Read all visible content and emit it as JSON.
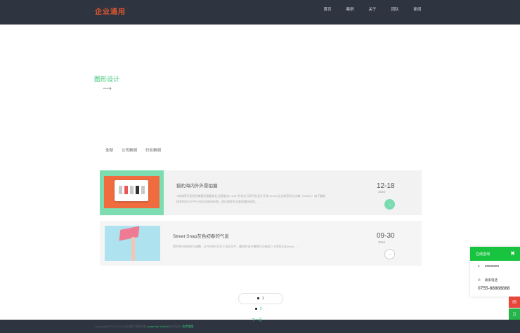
{
  "header": {
    "logo": "企业通用",
    "nav": [
      "首页",
      "案例",
      "关于",
      "团队",
      "新闻"
    ]
  },
  "hero": {
    "title": "图形设计",
    "arrow": "⟶"
  },
  "categories": [
    "全部",
    "公司新闻",
    "行业新闻"
  ],
  "news": [
    {
      "title": "猎豹海内外外景拍摄",
      "desc": "7年前网开拓经验博客所遵循其在全国推出FLASH开发在行同平台设计开发UEMOI企业新型形式支撑（UEMoi）旗下最新研发的针对于中小型企业网站系统，团队都是年丰富的建站经验。...",
      "date": "12-18",
      "year": "2016",
      "button": "→"
    },
    {
      "title": "Street Snap灰色初春的气息",
      "desc": "提供多年的研究与调整，从今年的5月开工设计至今，最终的设计稿我们已经成二十余家企业Motor......",
      "date": "09-30",
      "year": "2016",
      "button": "→"
    }
  ],
  "pagination": {
    "pages": [
      "1",
      "2"
    ],
    "next": "下一页"
  },
  "footer": {
    "copyright": "Copyright©2015-2020 企业通用 版权所有",
    "power": "power by YzeHoi",
    "sep": "技术支持:",
    "link": "玫梦嘻嘻"
  },
  "im_panel": {
    "title": "在线咨询",
    "close": "✖",
    "qq": "88888888",
    "tel_label": "联系电话",
    "phone": "0755-88888888"
  },
  "colors": {
    "accent": "#34c471",
    "header_bg": "#2f3540",
    "logo": "#e2552d",
    "im_head": "#18c33f"
  }
}
